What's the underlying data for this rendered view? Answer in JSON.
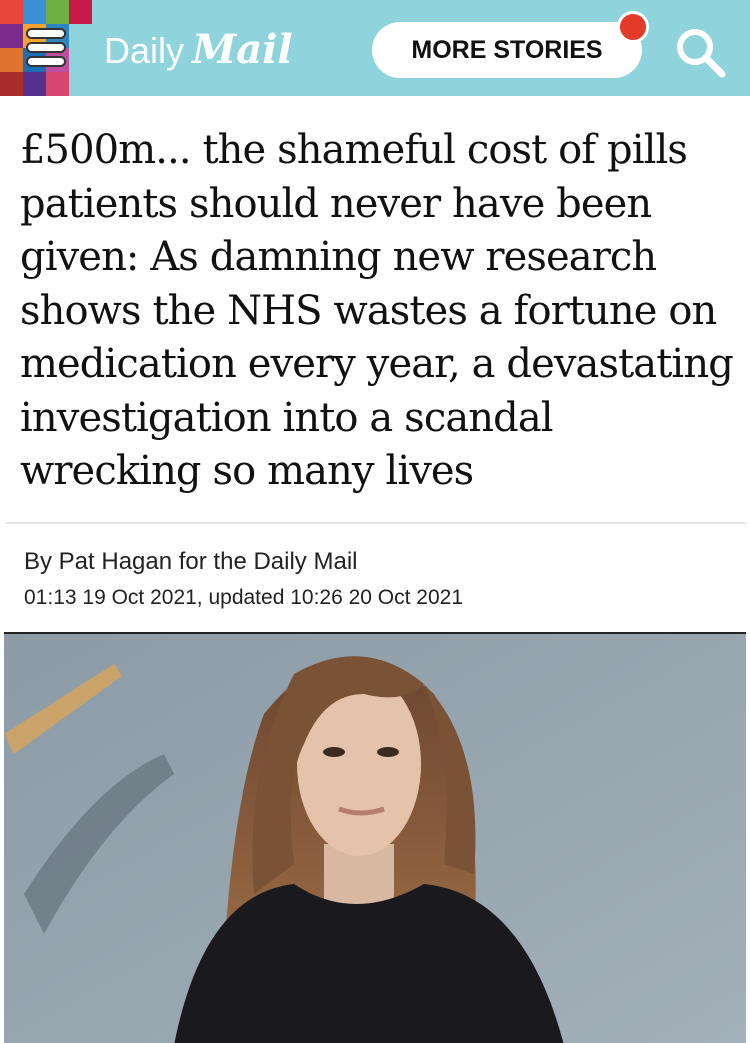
{
  "header": {
    "logo_daily": "Daily",
    "logo_mail": "Mail",
    "more_stories_label": "MORE STORIES",
    "background_color": "#8fd4dc",
    "notification_color": "#e23b2a",
    "menu_icon": "hamburger-menu-icon",
    "search_icon": "search-icon"
  },
  "article": {
    "headline": "£500m... the shameful cost of pills patients should never have been given: As damning new research shows the NHS wastes a fortune on medication every year, a devastating investigation into a scandal wrecking so many lives",
    "byline": "By Pat Hagan for the Daily Mail",
    "timestamp": "01:13 19 Oct 2021, updated 10:26 20 Oct 2021"
  }
}
